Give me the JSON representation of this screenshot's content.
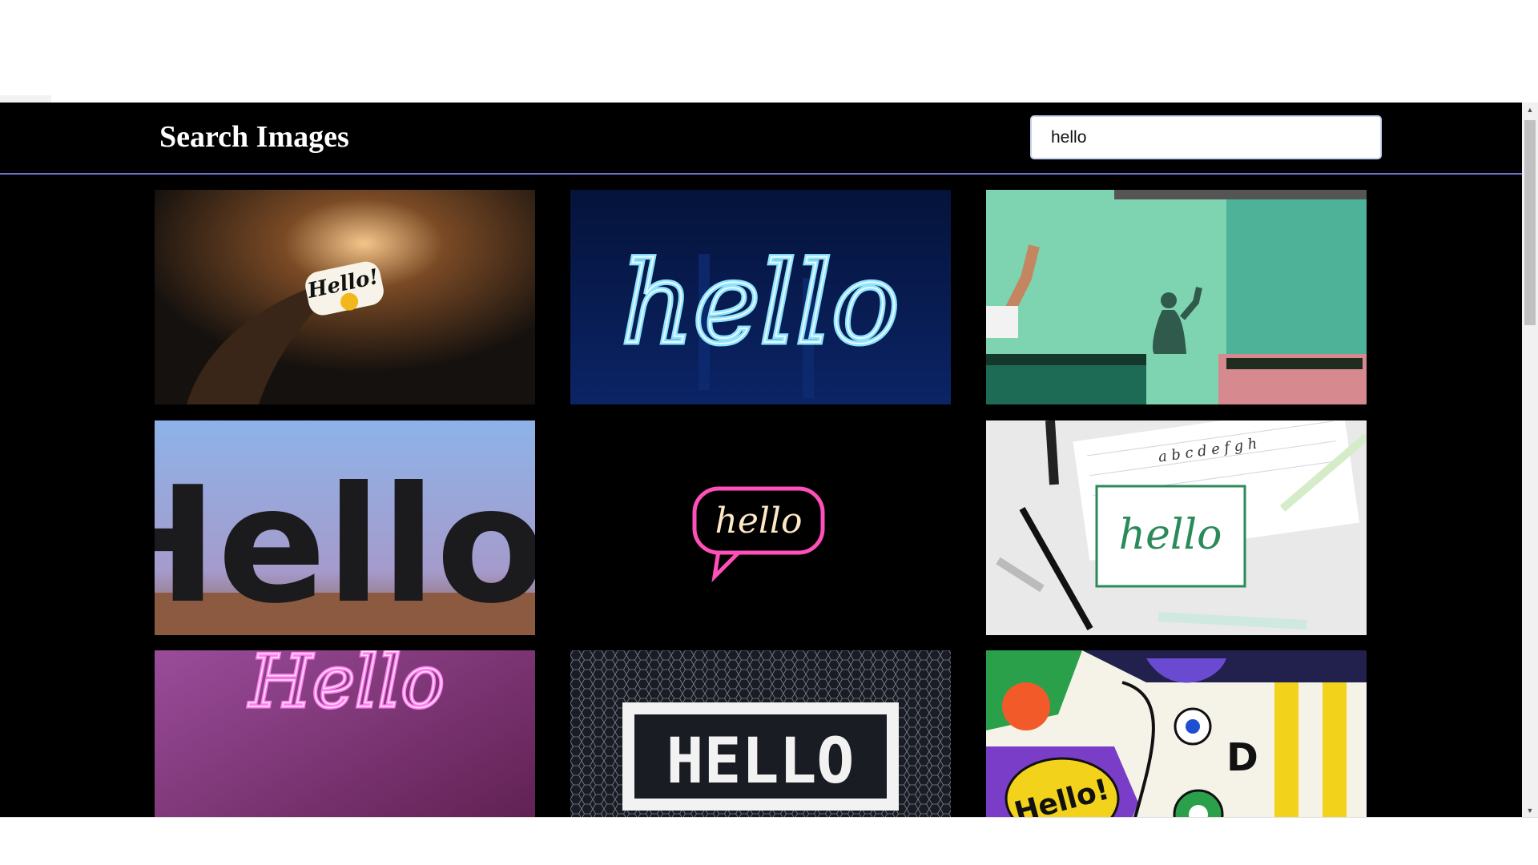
{
  "header": {
    "title": "Search Images"
  },
  "search": {
    "value": "hello",
    "placeholder": ""
  },
  "images": [
    {
      "theme": "hand holding Hello! smiley sticker",
      "text": "Hello!"
    },
    {
      "theme": "blue neon hello sign",
      "text": "hello"
    },
    {
      "theme": "person waving with shadow on mint wall",
      "text": ""
    },
    {
      "theme": "large black Hello letters",
      "text": "Hello"
    },
    {
      "theme": "pink neon speech bubble hello",
      "text": "hello"
    },
    {
      "theme": "hand lettering hello with pens",
      "text": "hello"
    },
    {
      "theme": "pink neon Hello on purple",
      "text": "Hello"
    },
    {
      "theme": "HELLO mosaic tiles",
      "text": "HELLO"
    },
    {
      "theme": "colorful graffiti Hello!",
      "text": "Hello!"
    }
  ],
  "scrollbar": {
    "up_icon": "arrow-up-icon",
    "down_icon": "arrow-down-icon"
  },
  "colors": {
    "background": "#000000",
    "header_border": "#6a74c9",
    "title": "#ffffff"
  }
}
